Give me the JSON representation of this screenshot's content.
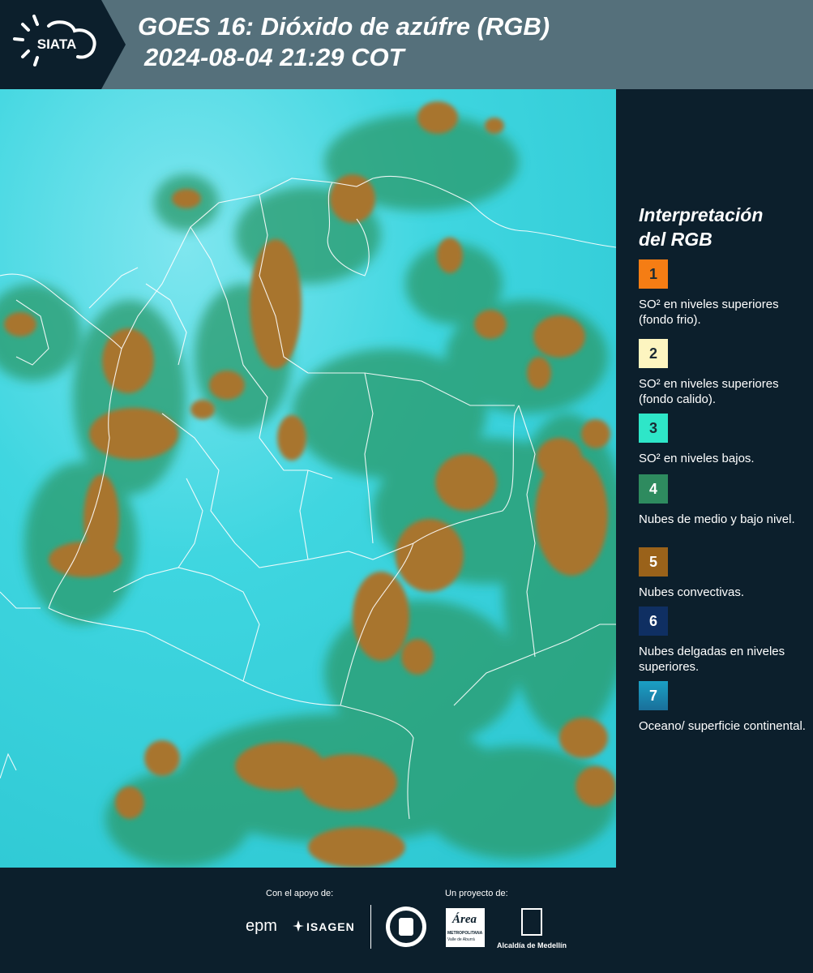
{
  "header": {
    "logo_text": "SIATA",
    "title_line1": "GOES 16: Dióxido de azúfre (RGB)",
    "title_line2": "2024-08-04 21:29 COT"
  },
  "legend": {
    "title_line1": "Interpretación",
    "title_line2": "del RGB",
    "items": [
      {
        "number": "1",
        "color": "#f57d14",
        "text": "SO² en niveles superiores (fondo frio)."
      },
      {
        "number": "2",
        "color": "#fdf5c0",
        "text": "SO² en niveles superiores (fondo calido)."
      },
      {
        "number": "3",
        "color": "#2ee6c8",
        "text": "SO² en niveles bajos."
      },
      {
        "number": "4",
        "color": "#2e8b5f",
        "text": "Nubes de medio y bajo nivel."
      },
      {
        "number": "5",
        "color": "#9a621a",
        "text": "Nubes convectivas."
      },
      {
        "number": "6",
        "color": "#0f2f62",
        "text": "Nubes delgadas en niveles superiores."
      },
      {
        "number": "7",
        "color": "#1e8fb5",
        "text": "Oceano/ superficie continental."
      }
    ]
  },
  "footer": {
    "support_label": "Con el apoyo de:",
    "project_label": "Un proyecto de:",
    "epm": "epm",
    "isagen": "ISAGEN",
    "metropolitana": "Área",
    "metropolitana_sub": "METROPOLITANA",
    "metropolitana_sub2": "Valle de Aburrá",
    "alcaldia": "Alcaldía de Medellín"
  }
}
